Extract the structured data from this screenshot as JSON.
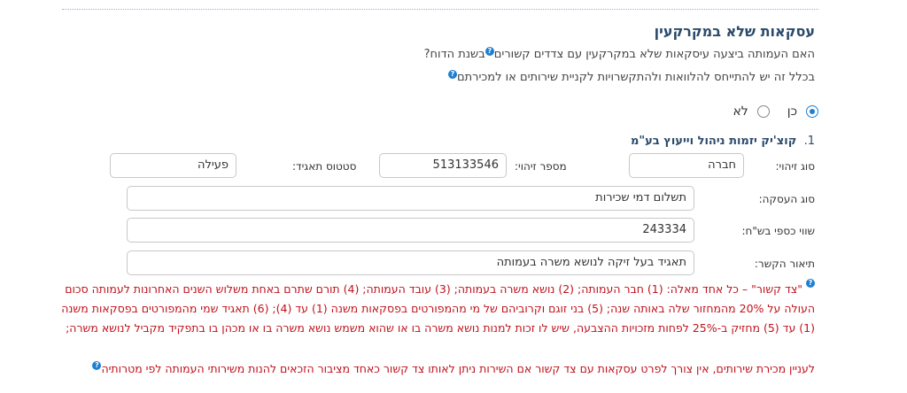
{
  "section": {
    "title": "עסקאות שלא במקרקעין",
    "question": "האם העמותה ביצעה עיסקאות שלא במקרקעין עם צדדים קשורים",
    "question_suffix": "בשנת הדוח?",
    "note": "בכלל זה יש להתייחס להלוואות ולהתקשרויות לקניית שירותים או למכירתם"
  },
  "radio": {
    "yes_label": "כן",
    "no_label": "לא",
    "selected": "yes"
  },
  "item": {
    "number": "1.",
    "name": "קוצ'יק יזמות ניהול וייעוץ בע\"מ",
    "id_type_label": "סוג זיהוי:",
    "id_type_value": "חברה",
    "id_number_label": "מספר זיהוי:",
    "id_number_value": "513133546",
    "status_label": "סטטוס תאגיד:",
    "status_value": "פעילה",
    "transaction_type_label": "סוג העסקה:",
    "transaction_type_value": "תשלום דמי שכירות",
    "value_label": "שווי כספי בש\"ח:",
    "value_value": "243334",
    "relation_label": "תיאור הקשר:",
    "relation_value": "תאגיד בעל זיקה לנושא משרה בעמותה"
  },
  "notes": {
    "related_party_definition": "\"צד קשור\" – כל אחד מאלה: (1) חבר העמותה; (2) נושא משרה בעמותה; (3) עובד העמותה; (4) תורם שתרם באחת משלוש השנים האחרונות לעמותה סכום העולה על 20% מהמחזור שלה באותה שנה; (5) בני זוגם וקרוביהם של מי מהמפורטים בפסקאות משנה (1) עד (4); (6) תאגיד שמי מהמפורטים בפסקאות משנה (1) עד (5) מחזיק ב-25% לפחות מזכויות ההצבעה, שיש לו זכות למנות נושא משרה בו או שהוא משמש נושא משרה בו או מכהן בו בתפקיד מקביל לנושא משרה;",
    "services_note": "לעניין מכירת שירותים, אין צורך לפרט עסקאות עם צד קשור אם השירות ניתן לאותו צד קשור כאחד מציבור הזכאים להנות משירותי העמותה לפי מטרותיה"
  },
  "icons": {
    "help": "question-circle-icon",
    "help_color": "#1e7fd1",
    "accent": "#2b4a6b",
    "note_color": "#c0121c"
  }
}
